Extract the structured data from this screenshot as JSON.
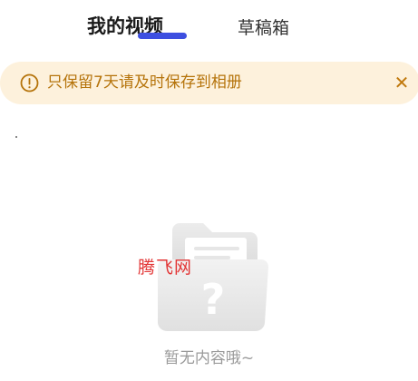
{
  "tabs": {
    "my_videos": "我的视频",
    "drafts": "草稿箱"
  },
  "banner": {
    "text": "只保留7天请及时保存到相册",
    "close_icon": "close-icon",
    "info_icon": "exclamation-circle-icon"
  },
  "empty_state": {
    "illustration_icon": "folder-question-icon",
    "watermark": "腾飞网",
    "message": "暂无内容哦~"
  },
  "colors": {
    "accent": "#3d4fe0",
    "banner_bg": "#fdf1dc",
    "banner_text": "#b5730a",
    "empty_text": "#9a9a9a"
  }
}
